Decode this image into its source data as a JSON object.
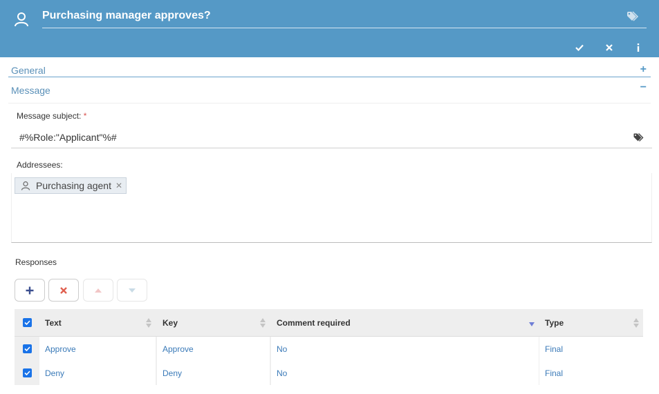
{
  "header": {
    "title": "Purchasing manager approves?",
    "bg_color": "#5599c6",
    "actions": [
      {
        "name": "confirm",
        "icon": "check-icon"
      },
      {
        "name": "cancel",
        "icon": "close-icon"
      },
      {
        "name": "info",
        "icon": "info-icon"
      }
    ]
  },
  "sections": {
    "general": {
      "label": "General",
      "toggle": "+"
    },
    "message": {
      "label": "Message",
      "toggle": "−"
    }
  },
  "message": {
    "subject_label": "Message subject:",
    "subject_required": "*",
    "subject_value": "#%Role:\"Applicant\"%#",
    "addressees_label": "Addressees:",
    "addressees": [
      {
        "label": "Purchasing agent",
        "icon": "user-icon"
      }
    ]
  },
  "responses": {
    "label": "Responses",
    "toolbar": [
      {
        "name": "add",
        "icon": "plus-icon",
        "enabled": true
      },
      {
        "name": "delete",
        "icon": "close-icon",
        "enabled": true
      },
      {
        "name": "move-up",
        "icon": "arrow-up-icon",
        "enabled": false
      },
      {
        "name": "move-down",
        "icon": "arrow-down-icon",
        "enabled": false
      }
    ],
    "columns": [
      "Text",
      "Key",
      "Comment required",
      "Type"
    ],
    "rows": [
      {
        "checked": true,
        "text": "Approve",
        "key": "Approve",
        "comment_required": "No",
        "type": "Final"
      },
      {
        "checked": true,
        "text": "Deny",
        "key": "Deny",
        "comment_required": "No",
        "type": "Final"
      }
    ],
    "sorted_column": "Comment required"
  }
}
